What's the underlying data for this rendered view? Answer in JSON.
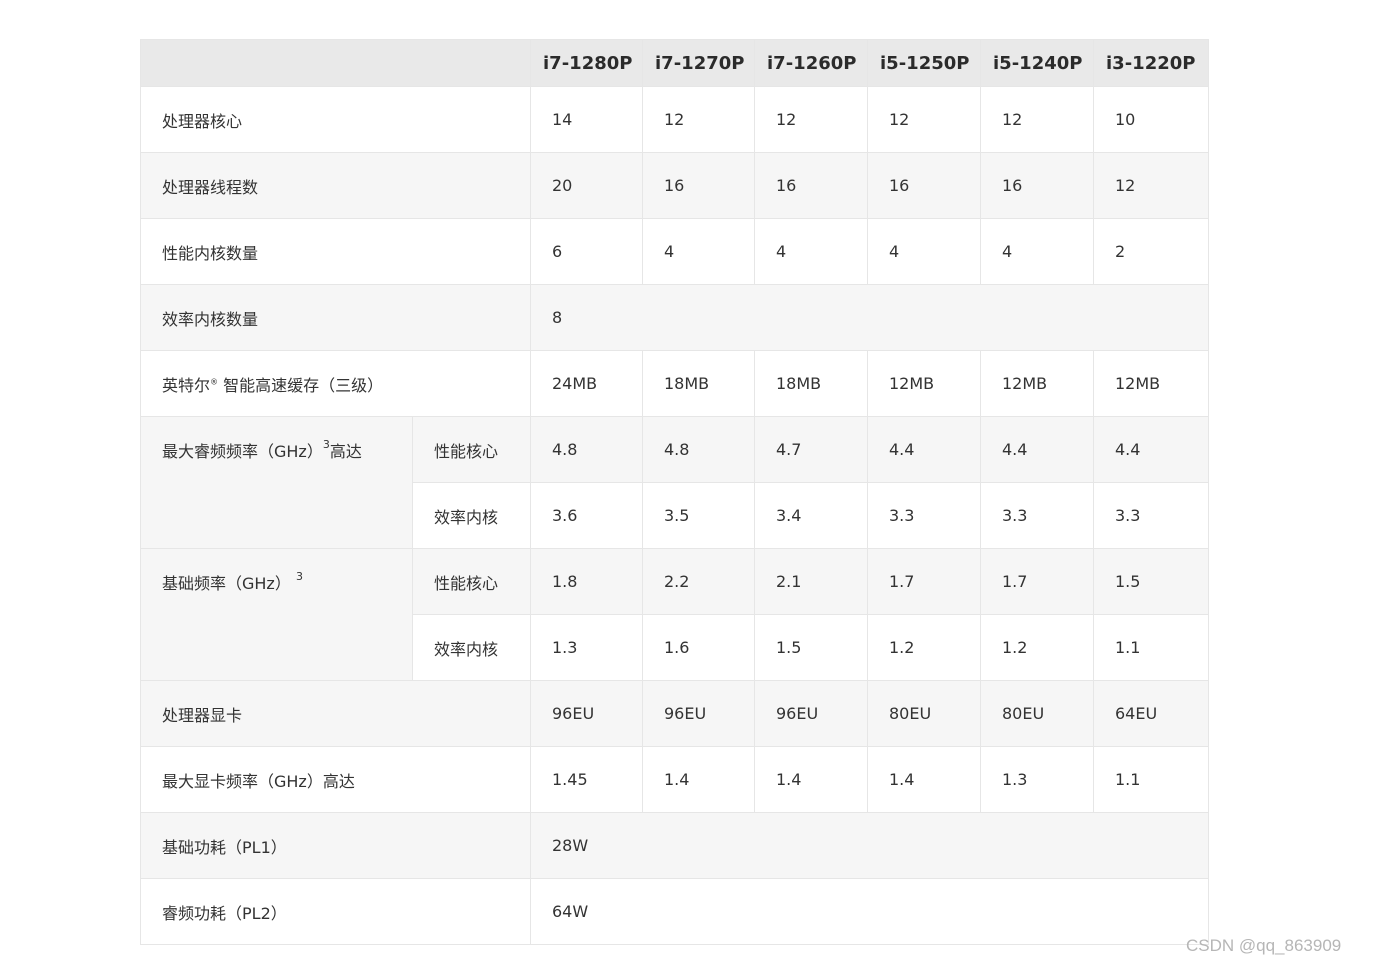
{
  "header": {
    "cols": [
      "i7-1280P",
      "i7-1270P",
      "i7-1260P",
      "i5-1250P",
      "i5-1240P",
      "i3-1220P"
    ]
  },
  "rows": {
    "cores": {
      "label": "处理器核心",
      "values": [
        "14",
        "12",
        "12",
        "12",
        "12",
        "10"
      ]
    },
    "threads": {
      "label": "处理器线程数",
      "values": [
        "20",
        "16",
        "16",
        "16",
        "16",
        "12"
      ]
    },
    "pcores": {
      "label": "性能内核数量",
      "values": [
        "6",
        "4",
        "4",
        "4",
        "4",
        "2"
      ]
    },
    "ecores": {
      "label": "效率内核数量",
      "value": "8"
    },
    "cache": {
      "label_a": "英特尔",
      "reg": "®",
      "label_b": " 智能高速缓存（三级）",
      "values": [
        "24MB",
        "18MB",
        "18MB",
        "12MB",
        "12MB",
        "12MB"
      ]
    },
    "turbo": {
      "label_a": "最大睿频频率（GHz）",
      "sup": "3",
      "label_b": "高达",
      "p": {
        "label": "性能核心",
        "values": [
          "4.8",
          "4.8",
          "4.7",
          "4.4",
          "4.4",
          "4.4"
        ]
      },
      "e": {
        "label": "效率内核",
        "values": [
          "3.6",
          "3.5",
          "3.4",
          "3.3",
          "3.3",
          "3.3"
        ]
      }
    },
    "base": {
      "label": "基础频率（GHz）",
      "sup": "3",
      "p": {
        "label": "性能核心",
        "values": [
          "1.8",
          "2.2",
          "2.1",
          "1.7",
          "1.7",
          "1.5"
        ]
      },
      "e": {
        "label": "效率内核",
        "values": [
          "1.3",
          "1.6",
          "1.5",
          "1.2",
          "1.2",
          "1.1"
        ]
      }
    },
    "gpu": {
      "label": "处理器显卡",
      "values": [
        "96EU",
        "96EU",
        "96EU",
        "80EU",
        "80EU",
        "64EU"
      ]
    },
    "gpufreq": {
      "label": "最大显卡频率（GHz）高达",
      "values": [
        "1.45",
        "1.4",
        "1.4",
        "1.4",
        "1.3",
        "1.1"
      ]
    },
    "pl1": {
      "label": "基础功耗（PL1）",
      "value": "28W"
    },
    "pl2": {
      "label": "睿频功耗（PL2）",
      "value": "64W"
    }
  },
  "watermark": "CSDN @qq_863909"
}
